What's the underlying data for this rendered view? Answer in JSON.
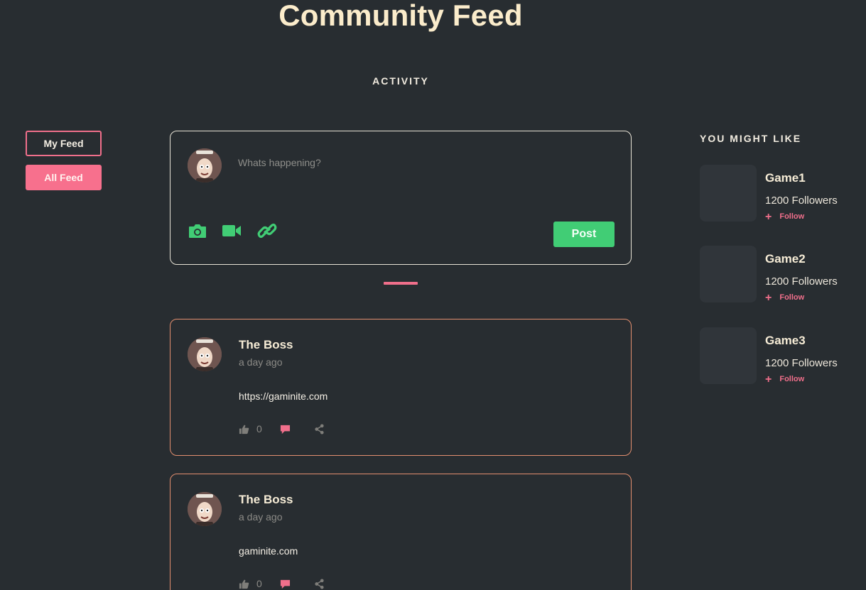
{
  "page": {
    "title": "Community Feed",
    "section_label": "ACTIVITY"
  },
  "nav": {
    "my_feed": "My Feed",
    "all_feed": "All Feed"
  },
  "composer": {
    "placeholder": "Whats happening?",
    "post_label": "Post",
    "icons": [
      "camera-icon",
      "video-icon",
      "link-icon"
    ]
  },
  "posts": [
    {
      "author": "The Boss",
      "time": "a day ago",
      "body": "https://gaminite.com",
      "likes": "0"
    },
    {
      "author": "The Boss",
      "time": "a day ago",
      "body": "gaminite.com",
      "likes": "0"
    }
  ],
  "suggestions": {
    "title": "YOU MIGHT LIKE",
    "follow_label": "Follow",
    "items": [
      {
        "name": "Game1",
        "followers": "1200 Followers"
      },
      {
        "name": "Game2",
        "followers": "1200 Followers"
      },
      {
        "name": "Game3",
        "followers": "1200 Followers"
      }
    ]
  },
  "colors": {
    "background": "#282d31",
    "accent_pink": "#f7708d",
    "accent_green": "#41cd75",
    "card_border_post": "#e38f6f",
    "card_border_composer": "#e8e3d6"
  }
}
